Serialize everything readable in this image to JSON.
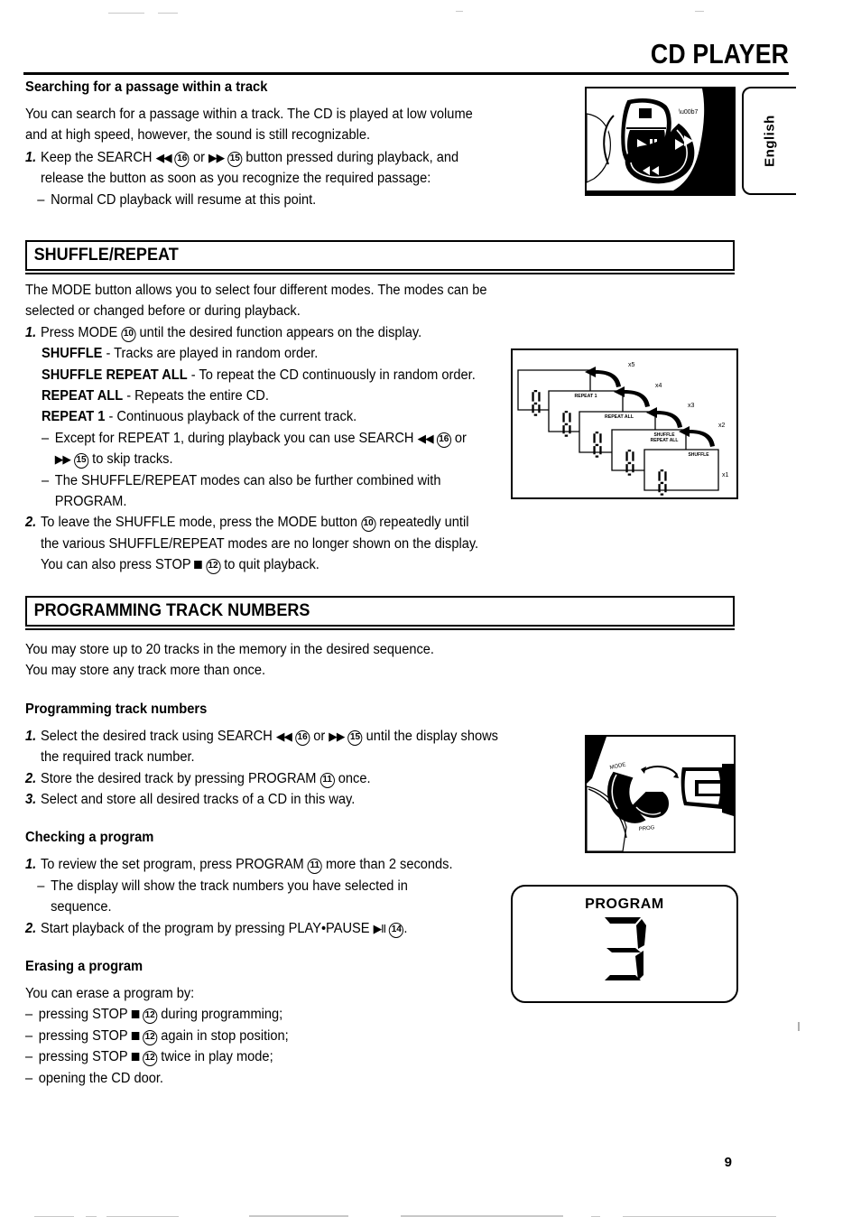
{
  "header": {
    "title": "CD PLAYER",
    "language_tab": "English"
  },
  "page_number": "9",
  "sections": [
    {
      "id": "searching",
      "heading": "Searching for a passage within a track",
      "paragraph": "You can search for a passage within a track. The CD is played at low volume and at high speed, however, the sound is still recognizable.",
      "steps": [
        {
          "marker": "1.",
          "text_before": "Keep the SEARCH",
          "glyph1": "◀◀",
          "ref1": "16",
          "mid": "or",
          "glyph2": "▶▶",
          "ref2": "15",
          "text_after": "button pressed during playback, and release the button as soon as you recognize the required passage:"
        }
      ],
      "notes": [
        {
          "marker": "–",
          "text": "Normal CD playback will resume at this point."
        }
      ]
    },
    {
      "id": "shuffle-repeat",
      "banner": "SHUFFLE/REPEAT",
      "intro": "The MODE button allows you to select four different modes. The modes can be selected or changed before or during playback.",
      "step1_marker": "1.",
      "step1_before": "Press MODE",
      "step1_ref": "10",
      "step1_after": "until the desired function appears on the display.",
      "modes": [
        {
          "name": "SHUFFLE",
          "dash": "-",
          "desc": "Tracks are played in random order."
        },
        {
          "name": "SHUFFLE REPEAT ALL",
          "dash": "-",
          "desc": "To repeat the CD continuously in random order."
        },
        {
          "name": "REPEAT ALL",
          "dash": "-",
          "desc": "Repeats the entire CD."
        },
        {
          "name": "REPEAT 1",
          "dash": "-",
          "desc": "Continuous playback of the current track."
        }
      ],
      "note1_before": "Except for REPEAT 1, during playback you can use SEARCH",
      "note1_glyph1": "◀◀",
      "note1_ref1": "16",
      "note1_mid": "or",
      "note1_glyph2": "▶▶",
      "note1_ref2": "15",
      "note1_after": "to skip tracks.",
      "note2": "The SHUFFLE/REPEAT modes can also be further combined with PROGRAM.",
      "step2_marker": "2.",
      "step2_before": "To leave the SHUFFLE mode, press the MODE button",
      "step2_ref": "10",
      "step2_mid": "repeatedly until the various SHUFFLE/REPEAT modes are no longer shown on the display. You can also press STOP",
      "step2_ref2": "12",
      "step2_after": "to quit playback."
    },
    {
      "id": "programming",
      "banner": "PROGRAMMING TRACK NUMBERS",
      "intro_line1": "You may store up to 20 tracks in the memory in the desired sequence.",
      "intro_line2": "You may store any track more than once.",
      "sub1_heading": "Programming track numbers",
      "sub1_steps": [
        {
          "marker": "1.",
          "before": "Select the desired track using SEARCH",
          "glyph1": "◀◀",
          "ref1": "16",
          "mid": "or",
          "glyph2": "▶▶",
          "ref2": "15",
          "after": "until the display shows the required track number."
        },
        {
          "marker": "2.",
          "before": "Store the desired track by pressing PROGRAM",
          "ref1": "11",
          "after": "once."
        },
        {
          "marker": "3.",
          "before": "Select and store all desired tracks of a CD in this way.",
          "ref1": "",
          "after": ""
        }
      ],
      "sub2_heading": "Checking a program",
      "sub2_step1_before": "To review the set program, press PROGRAM",
      "sub2_step1_ref": "11",
      "sub2_step1_after": "more than 2 seconds.",
      "sub2_note": "The display will show the track numbers you have selected in sequence.",
      "sub2_step2_before": "Start playback of the program by pressing PLAY•PAUSE",
      "sub2_step2_glyph": "▶II",
      "sub2_step2_ref": "14",
      "sub2_step2_after": ".",
      "sub3_heading": "Erasing a program",
      "sub3_intro": "You can erase a program by:",
      "sub3_items": [
        {
          "marker": "–",
          "before": "pressing STOP",
          "ref": "12",
          "after": "during programming;"
        },
        {
          "marker": "–",
          "before": "pressing STOP",
          "ref": "12",
          "after": "again in stop position;"
        },
        {
          "marker": "–",
          "before": "pressing STOP",
          "ref": "12",
          "after": "twice in play mode;"
        },
        {
          "marker": "–",
          "before": "opening the CD door.",
          "ref": "",
          "after": ""
        }
      ]
    }
  ],
  "figures": {
    "photo_buttons": {
      "name": "cd-player-transport-buttons-photo",
      "caption": ""
    },
    "photo_mode": {
      "name": "cd-player-mode-program-buttons-photo",
      "caption": ""
    },
    "shuffle_diagram": {
      "name": "shuffle-repeat-mode-sequence-diagram",
      "panels": [
        {
          "label": "",
          "digit": "8"
        },
        {
          "label": "REPEAT 1",
          "digit": "8"
        },
        {
          "label": "REPEAT ALL",
          "digit": "8"
        },
        {
          "label": "SHUFFLE REPEAT ALL",
          "digit": "8"
        },
        {
          "label": "SHUFFLE",
          "digit": "8"
        }
      ],
      "arrows": [
        "x1",
        "x2",
        "x3",
        "x4",
        "x5"
      ]
    },
    "lcd_program": {
      "label": "PROGRAM",
      "digit": "3"
    }
  }
}
